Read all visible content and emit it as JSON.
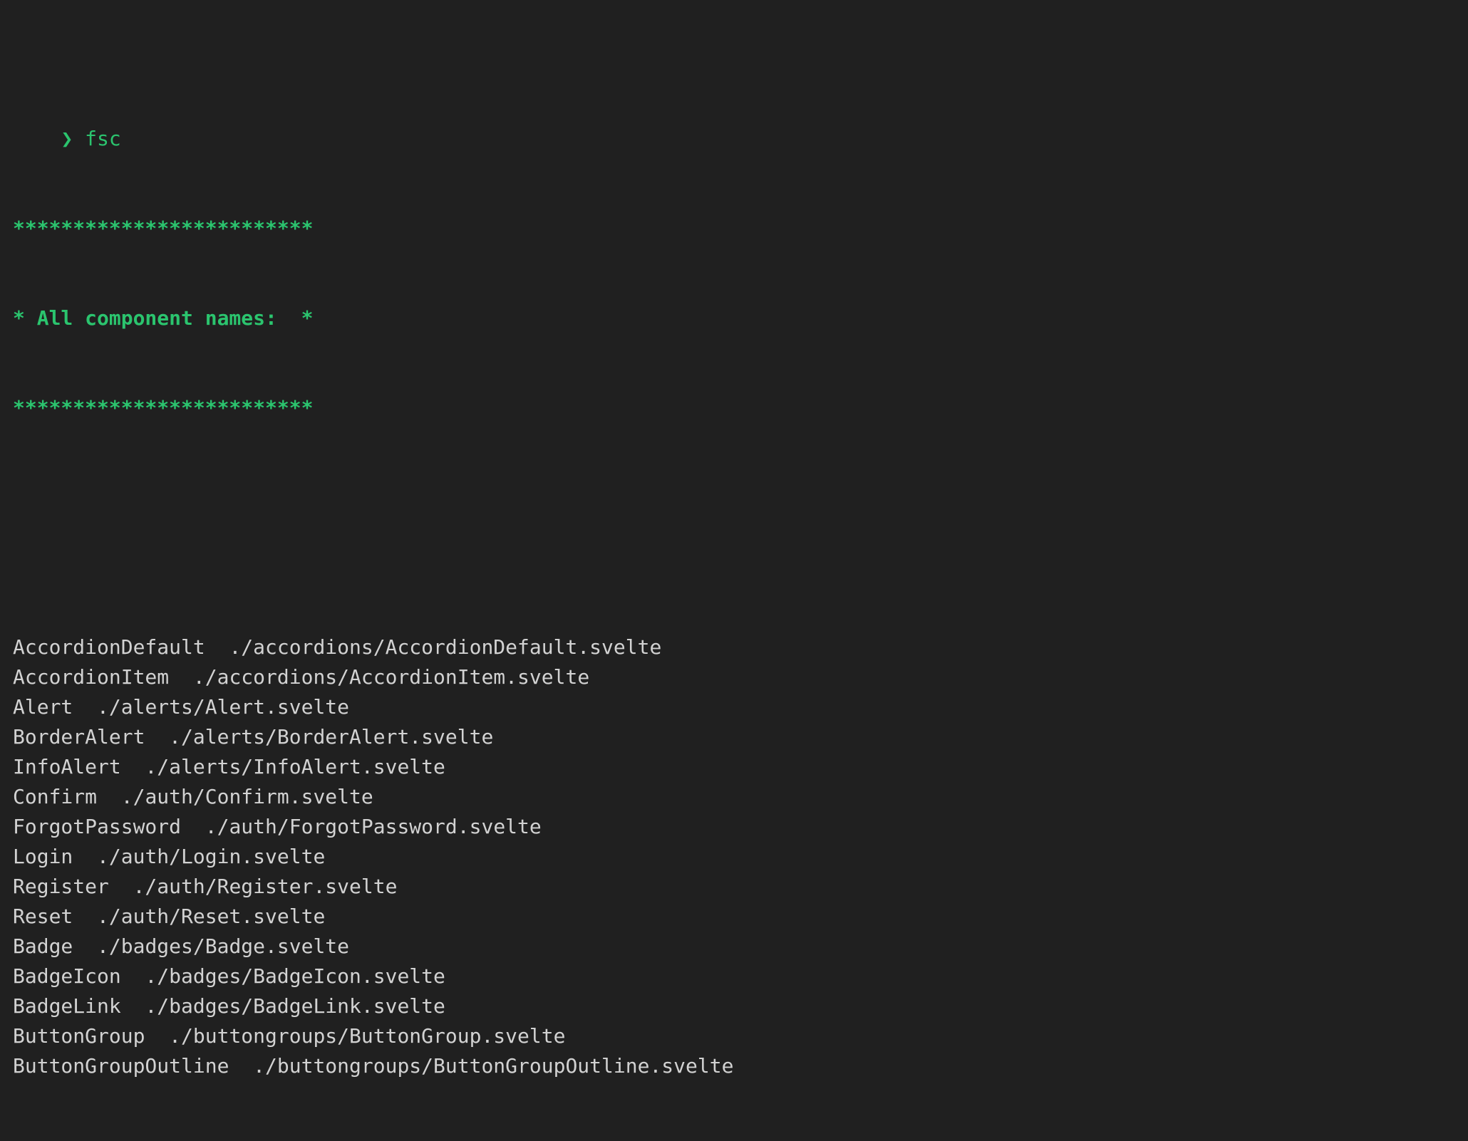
{
  "terminal": {
    "background_color": "#202020",
    "prompt_color": "#2bc46e",
    "text_color": "#d2d2d2",
    "prompt_symbol": "❯",
    "command": "fsc"
  },
  "banner": {
    "top_rule": "*************************",
    "title_line": "* All component names:  *",
    "bottom_rule": "*************************"
  },
  "components": [
    {
      "name": "AccordionDefault",
      "path": "./accordions/AccordionDefault.svelte"
    },
    {
      "name": "AccordionItem",
      "path": "./accordions/AccordionItem.svelte"
    },
    {
      "name": "Alert",
      "path": "./alerts/Alert.svelte"
    },
    {
      "name": "BorderAlert",
      "path": "./alerts/BorderAlert.svelte"
    },
    {
      "name": "InfoAlert",
      "path": "./alerts/InfoAlert.svelte"
    },
    {
      "name": "Confirm",
      "path": "./auth/Confirm.svelte"
    },
    {
      "name": "ForgotPassword",
      "path": "./auth/ForgotPassword.svelte"
    },
    {
      "name": "Login",
      "path": "./auth/Login.svelte"
    },
    {
      "name": "Register",
      "path": "./auth/Register.svelte"
    },
    {
      "name": "Reset",
      "path": "./auth/Reset.svelte"
    },
    {
      "name": "Badge",
      "path": "./badges/Badge.svelte"
    },
    {
      "name": "BadgeIcon",
      "path": "./badges/BadgeIcon.svelte"
    },
    {
      "name": "BadgeLink",
      "path": "./badges/BadgeLink.svelte"
    },
    {
      "name": "ButtonGroup",
      "path": "./buttongroups/ButtonGroup.svelte"
    },
    {
      "name": "ButtonGroupOutline",
      "path": "./buttongroups/ButtonGroupOutline.svelte"
    }
  ]
}
